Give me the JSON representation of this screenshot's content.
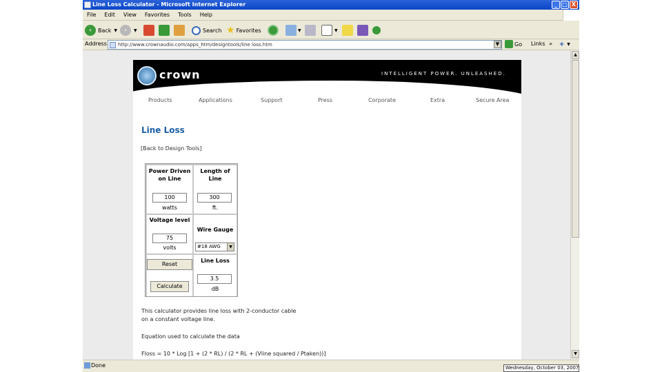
{
  "window": {
    "title": "Line Loss Calculator - Microsoft Internet Explorer",
    "buttons": [
      "_",
      "□",
      "X"
    ]
  },
  "menu": [
    "File",
    "Edit",
    "View",
    "Favorites",
    "Tools",
    "Help"
  ],
  "toolbar": {
    "back_label": "Back",
    "search_label": "Search",
    "favorites_label": "Favorites"
  },
  "address": {
    "label": "Address",
    "url": "http://www.crownaudio.com/apps_htm/designtools/line loss.htm",
    "go_label": "Go",
    "links_label": "Links"
  },
  "site": {
    "logo": "crown",
    "tagline": "INTELLIGENT POWER. UNLEASHED.",
    "nav": [
      "Products",
      "Applications",
      "Support",
      "Press",
      "Corporate",
      "Extra",
      "Secure Area"
    ]
  },
  "page": {
    "title": "Line Loss",
    "back_link": "[Back to Design Tools]"
  },
  "calculator": {
    "power_label_1": "Power Driven",
    "power_label_2": "on Line",
    "power_value": "100",
    "power_unit": "watts",
    "length_label_1": "Length of",
    "length_label_2": "Line",
    "length_value": "300",
    "length_unit": "ft.",
    "voltage_label": "Voltage level",
    "voltage_value": "75",
    "voltage_unit": "volts",
    "gauge_label": "Wire Gauge",
    "gauge_value": "#18 AWG",
    "reset_label": "Reset",
    "calculate_label": "Calculate",
    "loss_label": "Line Loss",
    "loss_value": "3.5",
    "loss_unit": "dB"
  },
  "description": {
    "line1": "This calculator provides line loss with 2-conductor cable",
    "line2": "on a constant voltage line.",
    "line3": "Equation used to calculate the data",
    "line4": "Floss = 10 * Log [1 + (2 * RL) / (2 * RL + (Vline squared / Ptaken))]"
  },
  "status": {
    "text": "Done",
    "date": "Wednesday, October 03, 2007"
  }
}
